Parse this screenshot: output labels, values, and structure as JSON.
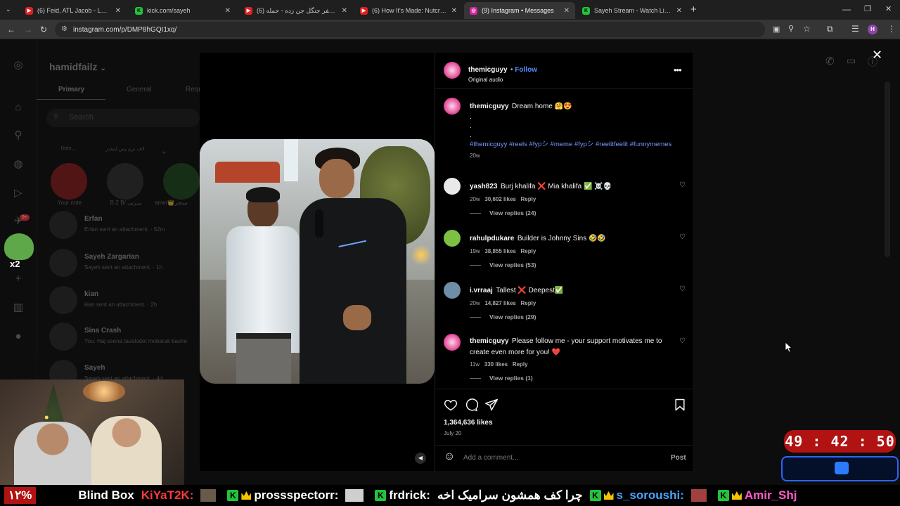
{
  "browser": {
    "tabs": [
      {
        "title": "(6) Feid, ATL Jacob - LUNA (Offi",
        "favicon": "youtube",
        "color": "#e02020",
        "active": false
      },
      {
        "title": "kick.com/sayeh",
        "favicon": "kick",
        "color": "#22c33a",
        "active": false
      },
      {
        "title": "(6) آغاز سفر جنگل جن زده - حمله",
        "favicon": "youtube",
        "color": "#e02020",
        "active": false
      },
      {
        "title": "(6) How It's Made: Nutcrackers",
        "favicon": "youtube",
        "color": "#e02020",
        "active": false
      },
      {
        "title": "(9) Instagram • Messages",
        "favicon": "instagram",
        "color": "#d6249f",
        "active": true
      },
      {
        "title": "Sayeh Stream - Watch Live on K",
        "favicon": "kick",
        "color": "#22c33a",
        "active": false
      }
    ],
    "url": "instagram.com/p/DMP8hGQI1xq/",
    "profile_initial": "H"
  },
  "instagram": {
    "account": "hamidfailz",
    "dm_tabs": [
      "Primary",
      "General",
      "Requ"
    ],
    "search_placeholder": "Search",
    "notes": [
      {
        "label": "Note...",
        "name": "Your note"
      },
      {
        "label": "لاف نزن پس اینقدر",
        "name": "B Z B/ بیـزبی"
      },
      {
        "label": "ید",
        "name": "amer👑سنجر"
      }
    ],
    "notification_badge": "9+",
    "threads": [
      {
        "name": "Erfan",
        "preview": "Erfan sent an attachment.",
        "time": "52m"
      },
      {
        "name": "Sayeh Zargarian",
        "preview": "Sayeh sent an attachment.",
        "time": "1h"
      },
      {
        "name": "kian",
        "preview": "kian sent an attachment.",
        "time": "2h"
      },
      {
        "name": "Sina Crash",
        "preview": "You: Haj seena tavalodet mobarak bashe",
        "time": ""
      },
      {
        "name": "Sayeh",
        "preview": "Sayeh sent an attachment.",
        "time": "4d"
      }
    ]
  },
  "post": {
    "author": "themicguyy",
    "follow_label": "Follow",
    "audio": "Original audio",
    "caption_user": "themicguyy",
    "caption_text": "Dream home 🤗😍",
    "caption_dots": [
      ".",
      ".",
      "."
    ],
    "hashtags": "#themicguyy #reels #fypシ #meme #fypシ #reelitfeelit #funnymemes",
    "caption_age": "20w",
    "comments": [
      {
        "user": "yash823",
        "text": "Burj khalifa ❌ Mia khalifa ✅ ☠️💀",
        "age": "20w",
        "likes": "30,602 likes",
        "reply": "Reply",
        "replies": "View replies (24)"
      },
      {
        "user": "rahulpdukare",
        "text": "Builder is Johnny Sins 🤣🤣",
        "age": "19w",
        "likes": "38,855 likes",
        "reply": "Reply",
        "replies": "View replies (53)"
      },
      {
        "user": "i.vrraaj",
        "text": "Tallest ❌ Deepest✅",
        "age": "20w",
        "likes": "14,827 likes",
        "reply": "Reply",
        "replies": "View replies (29)"
      },
      {
        "user": "themicguyy",
        "text": "Please follow me - your support motivates me to create even more for you! ❤️",
        "age": "11w",
        "likes": "330 likes",
        "reply": "Reply",
        "replies": "View replies (1)"
      }
    ],
    "like_count": "1,364,636 likes",
    "date": "July 20",
    "comment_placeholder": "Add a comment...",
    "post_label": "Post"
  },
  "stream": {
    "timer": "49 : 42 : 50",
    "ticker_items": [
      "Blind Box",
      "KiYaT2K:",
      "prossspectorr:",
      "frdrick:",
      "چرا کف همشون سرامیک اخه",
      "s_soroushi:",
      "Amir_Shj"
    ],
    "percent_badge": "۱۲%",
    "gif_badge": "x2"
  },
  "colors": {
    "accent": "#0095f6",
    "timer_bg": "#b11212",
    "kick_green": "#22c33a"
  }
}
